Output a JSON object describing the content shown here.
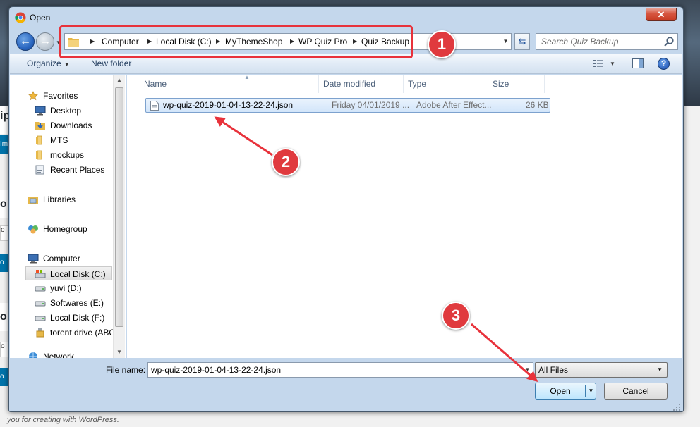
{
  "window": {
    "title": "Open",
    "close_label": "✕",
    "app_icon": "chrome-icon"
  },
  "navigation": {
    "back_icon": "back-arrow-icon",
    "forward_icon": "forward-arrow-icon",
    "breadcrumbs": [
      "Computer",
      "Local Disk (C:)",
      "MyThemeShop",
      "WP Quiz Pro",
      "Quiz Backup"
    ],
    "search_placeholder": "Search Quiz Backup"
  },
  "toolbar": {
    "organize_label": "Organize",
    "new_folder_label": "New folder"
  },
  "sidebar": {
    "items": [
      {
        "label": "Favorites",
        "icon": "star-icon"
      },
      {
        "label": "Desktop",
        "icon": "desktop-icon"
      },
      {
        "label": "Downloads",
        "icon": "downloads-icon"
      },
      {
        "label": "MTS",
        "icon": "folder-icon"
      },
      {
        "label": "mockups",
        "icon": "folder-icon"
      },
      {
        "label": "Recent Places",
        "icon": "recent-places-icon"
      },
      {
        "label": "Libraries",
        "icon": "libraries-icon"
      },
      {
        "label": "Homegroup",
        "icon": "homegroup-icon"
      },
      {
        "label": "Computer",
        "icon": "computer-icon"
      },
      {
        "label": "Local Disk (C:)",
        "icon": "drive-windows-icon"
      },
      {
        "label": "yuvi (D:)",
        "icon": "drive-icon"
      },
      {
        "label": "Softwares (E:)",
        "icon": "drive-icon"
      },
      {
        "label": "Local Disk (F:)",
        "icon": "drive-icon"
      },
      {
        "label": "torent drive (ABC",
        "icon": "usb-drive-icon"
      },
      {
        "label": "Network",
        "icon": "network-icon"
      }
    ],
    "selected": "Local Disk (C:)"
  },
  "file_list": {
    "columns": [
      "Name",
      "Date modified",
      "Type",
      "Size"
    ],
    "rows": [
      {
        "name": "wp-quiz-2019-01-04-13-22-24.json",
        "date": "Friday 04/01/2019 ...",
        "type": "Adobe After Effect...",
        "size": "26 KB"
      }
    ]
  },
  "footer": {
    "filename_label": "File name:",
    "filename_value": "wp-quiz-2019-01-04-13-22-24.json",
    "filetype_value": "All Files",
    "open_label": "Open",
    "cancel_label": "Cancel"
  },
  "annotations": {
    "step1": "1",
    "step2": "2",
    "step3": "3",
    "color": "#e03a3e"
  },
  "background_page": {
    "footer_text": "you for creating with WordPress."
  }
}
